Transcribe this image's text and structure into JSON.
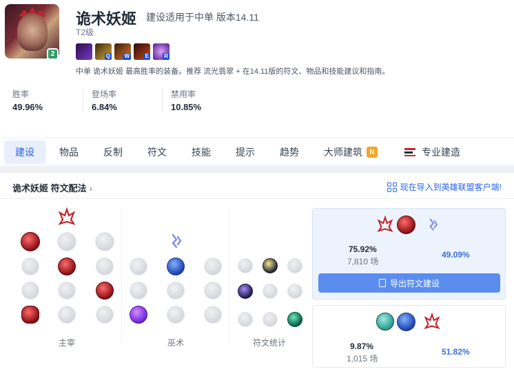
{
  "champion": {
    "name": "诡术妖姬",
    "subtitle": "建设适用于中单 版本14.11",
    "tier": "T2级",
    "level_badge": "2",
    "skills": [
      {
        "key": "",
        "color": "#5b2a8c",
        "icon": "passive-icon"
      },
      {
        "key": "Q",
        "color": "#c08a1e",
        "icon": "q-skill-icon"
      },
      {
        "key": "W",
        "color": "#b03a1e",
        "icon": "w-skill-icon"
      },
      {
        "key": "E",
        "color": "#8a2a1a",
        "icon": "e-skill-icon"
      },
      {
        "key": "R",
        "color": "#6a2aa8",
        "icon": "r-skill-icon"
      }
    ],
    "description": "中单 诡术妖姬 最高胜率的装备。推荐 流光翡翠 + 在14.11版的符文、物品和技能建议和指南。"
  },
  "stats": [
    {
      "label": "胜率",
      "value": "49.96%"
    },
    {
      "label": "登场率",
      "value": "6.84%"
    },
    {
      "label": "禁用率",
      "value": "10.85%"
    }
  ],
  "tabs": [
    "建设",
    "物品",
    "反制",
    "符文",
    "技能",
    "提示",
    "趋势",
    "大师建筑",
    "专业建造"
  ],
  "tab_badge": "N",
  "active_tab": "建设",
  "runes_panel": {
    "title": "诡术妖姬 符文配法",
    "chevron": "›",
    "import_label": "现在导入到英雄联盟客户端!",
    "col_labels": [
      "主宰",
      "巫术",
      "符文统计"
    ]
  },
  "rune_pages": [
    {
      "pick_rate": "75.92%",
      "games": "7,810 场",
      "win_rate": "49.09%",
      "export_label": "导出符文建设"
    },
    {
      "pick_rate": "9.87%",
      "games": "1,015 场",
      "win_rate": "51.82%"
    }
  ],
  "colors": {
    "accent": "#2563eb",
    "win": "#3b6fd1",
    "domination": "#c0262d"
  }
}
